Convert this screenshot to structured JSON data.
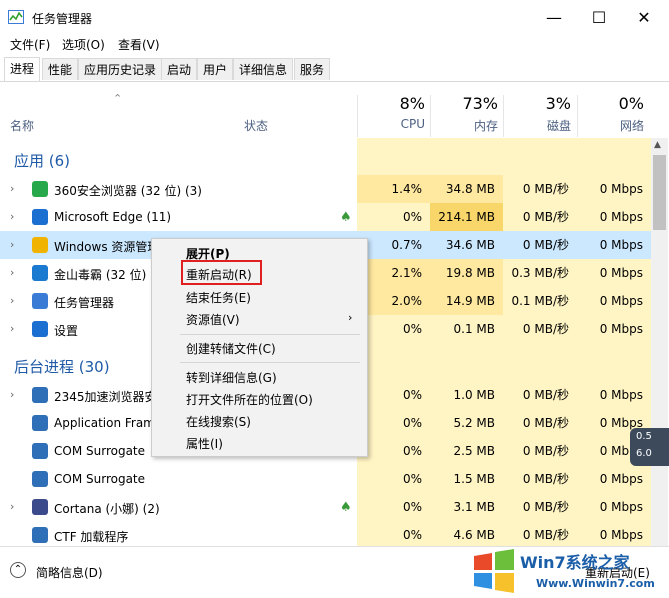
{
  "window": {
    "title": "任务管理器"
  },
  "menu": [
    "文件(F)",
    "选项(O)",
    "查看(V)"
  ],
  "tabs": [
    "进程",
    "性能",
    "应用历史记录",
    "启动",
    "用户",
    "详细信息",
    "服务"
  ],
  "columns": {
    "name": "名称",
    "status": "状态",
    "cpu": {
      "pct": "8%",
      "label": "CPU"
    },
    "mem": {
      "pct": "73%",
      "label": "内存"
    },
    "disk": {
      "pct": "3%",
      "label": "磁盘"
    },
    "net": {
      "pct": "0%",
      "label": "网络"
    }
  },
  "sections": {
    "apps": "应用 (6)",
    "background": "后台进程 (30)"
  },
  "rows": [
    {
      "name": "360安全浏览器 (32 位) (3)",
      "cpu": "1.4%",
      "mem": "34.8 MB",
      "disk": "0 MB/秒",
      "net": "0 Mbps"
    },
    {
      "name": "Microsoft Edge (11)",
      "cpu": "0%",
      "mem": "214.1 MB",
      "disk": "0 MB/秒",
      "net": "0 Mbps"
    },
    {
      "name": "Windows 资源管理",
      "cpu": "0.7%",
      "mem": "34.6 MB",
      "disk": "0 MB/秒",
      "net": "0 Mbps"
    },
    {
      "name": "金山毒霸 (32 位) (",
      "cpu": "2.1%",
      "mem": "19.8 MB",
      "disk": "0.3 MB/秒",
      "net": "0 Mbps"
    },
    {
      "name": "任务管理器",
      "cpu": "2.0%",
      "mem": "14.9 MB",
      "disk": "0.1 MB/秒",
      "net": "0 Mbps"
    },
    {
      "name": "设置",
      "cpu": "0%",
      "mem": "0.1 MB",
      "disk": "0 MB/秒",
      "net": "0 Mbps"
    },
    {
      "name": "2345加速浏览器安",
      "cpu": "0%",
      "mem": "1.0 MB",
      "disk": "0 MB/秒",
      "net": "0 Mbps"
    },
    {
      "name": "Application Fram",
      "cpu": "0%",
      "mem": "5.2 MB",
      "disk": "0 MB/秒",
      "net": "0 Mbps"
    },
    {
      "name": "COM Surrogate",
      "cpu": "0%",
      "mem": "2.5 MB",
      "disk": "0 MB/秒",
      "net": "0 Mbps"
    },
    {
      "name": "COM Surrogate",
      "cpu": "0%",
      "mem": "1.5 MB",
      "disk": "0 MB/秒",
      "net": "0 Mbps"
    },
    {
      "name": "Cortana (小娜) (2)",
      "cpu": "0%",
      "mem": "3.1 MB",
      "disk": "0 MB/秒",
      "net": "0 Mbps"
    },
    {
      "name": "CTF 加载程序",
      "cpu": "0%",
      "mem": "4.6 MB",
      "disk": "0 MB/秒",
      "net": "0 Mbps"
    }
  ],
  "context_menu": [
    "展开(P)",
    "重新启动(R)",
    "结束任务(E)",
    "资源值(V)",
    "创建转储文件(C)",
    "转到详细信息(G)",
    "打开文件所在的位置(O)",
    "在线搜索(S)",
    "属性(I)"
  ],
  "bottom": {
    "fewer_details": "简略信息(D)",
    "restart_button": "重新启动(E)"
  },
  "watermark": {
    "brand": "Win7系统之家",
    "url": "Www.Winwin7.com"
  },
  "side_widget": [
    "0.5",
    "6.0"
  ],
  "colors": {
    "heat_light": "#fff4c4",
    "heat_medium": "#ffe9a0",
    "heat_strong": "#f9d66a",
    "section_blue": "#1f5aa6",
    "highlight_red": "#e02020"
  }
}
